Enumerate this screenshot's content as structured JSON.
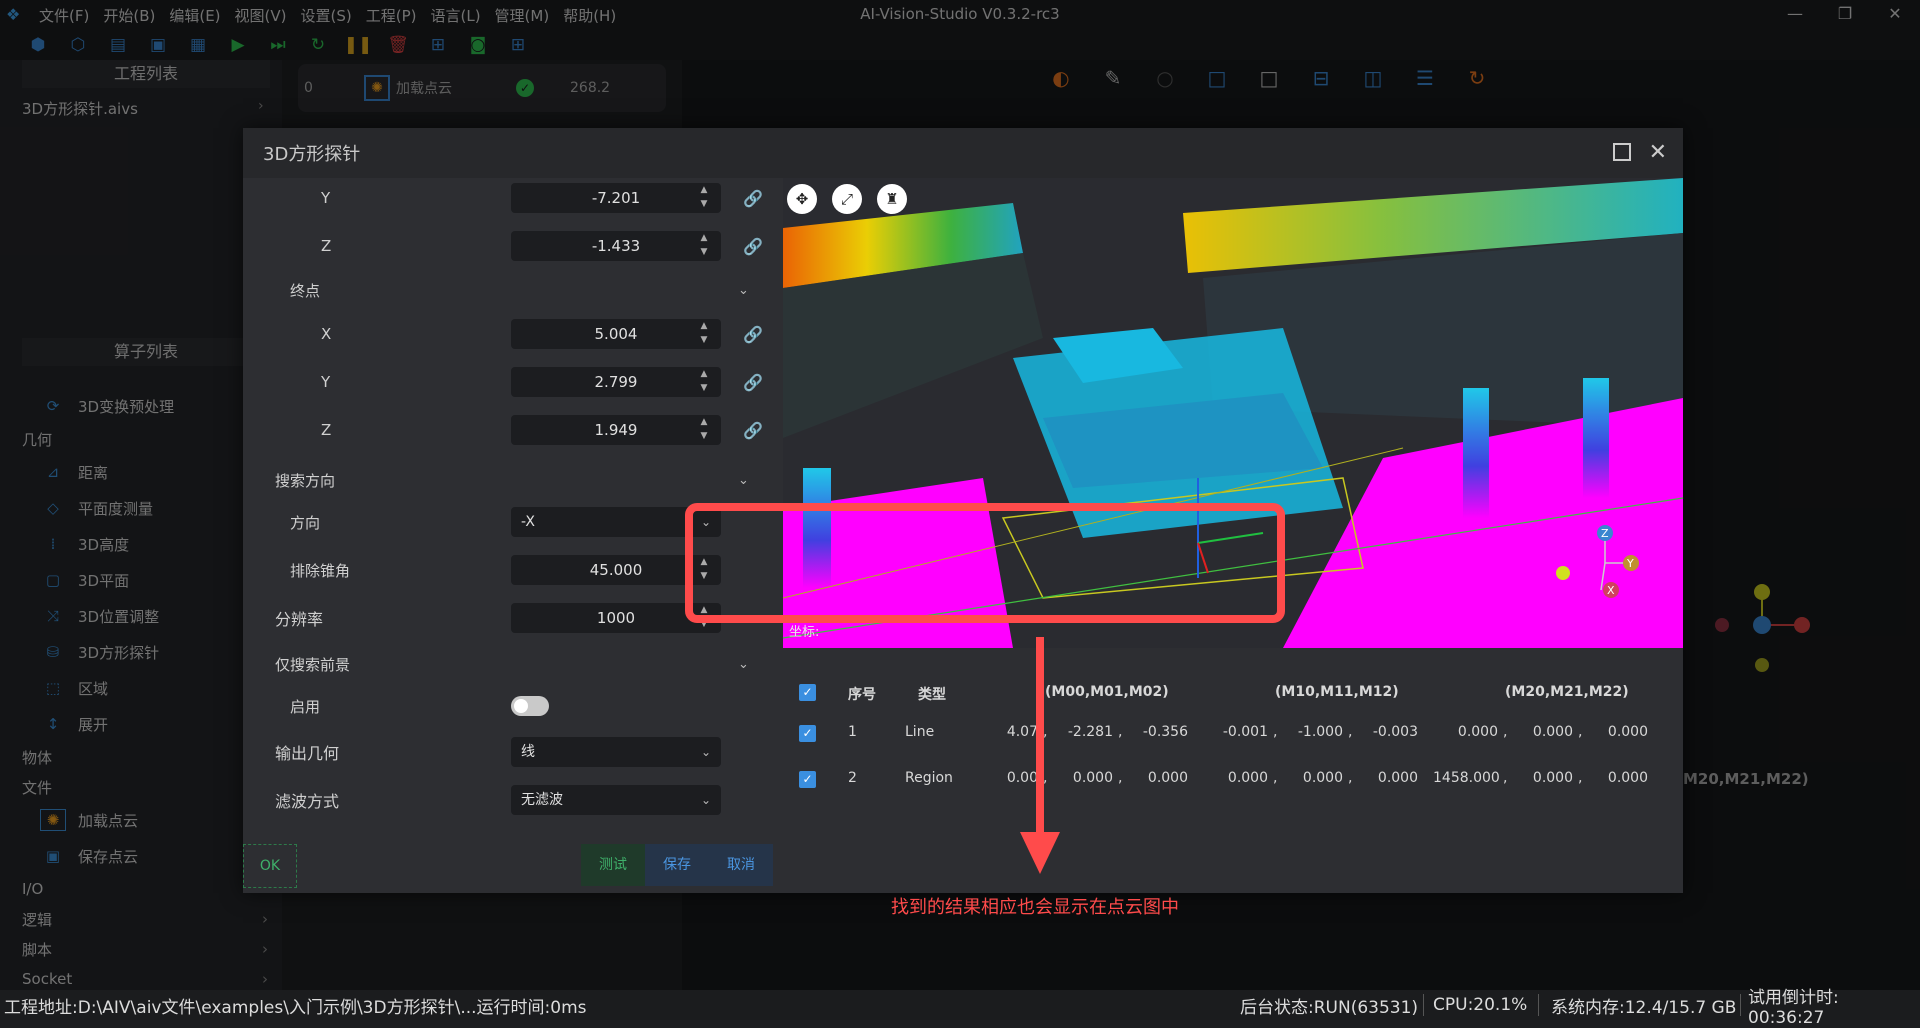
{
  "window": {
    "title": "AI-Vision-Studio V0.3.2-rc3",
    "menus": [
      "文件(F)",
      "开始(B)",
      "编辑(E)",
      "视图(V)",
      "设置(S)",
      "工程(P)",
      "语言(L)",
      "管理(M)",
      "帮助(H)"
    ]
  },
  "project_panel": {
    "title": "工程列表",
    "file": "3D方形探针.aivs"
  },
  "operator_panel": {
    "title": "算子列表",
    "items": [
      {
        "kind": "item",
        "label": "3D变换预处理",
        "icon": "transform-icon"
      },
      {
        "kind": "cat",
        "label": "几何"
      },
      {
        "kind": "item",
        "label": "距离",
        "icon": "distance-icon"
      },
      {
        "kind": "item",
        "label": "平面度测量",
        "icon": "flatness-icon"
      },
      {
        "kind": "item",
        "label": "3D高度",
        "icon": "height-icon"
      },
      {
        "kind": "item",
        "label": "3D平面",
        "icon": "plane-icon"
      },
      {
        "kind": "item",
        "label": "3D位置调整",
        "icon": "position-adjust-icon"
      },
      {
        "kind": "item",
        "label": "3D方形探针",
        "icon": "probe-icon"
      },
      {
        "kind": "item",
        "label": "区域",
        "icon": "region-icon"
      },
      {
        "kind": "item",
        "label": "展开",
        "icon": "expand-icon"
      },
      {
        "kind": "cat",
        "label": "物体"
      },
      {
        "kind": "cat",
        "label": "文件"
      },
      {
        "kind": "item",
        "label": "加载点云",
        "icon": "load-cloud-icon"
      },
      {
        "kind": "item",
        "label": "保存点云",
        "icon": "save-cloud-icon"
      },
      {
        "kind": "cat",
        "label": "I/O"
      },
      {
        "kind": "cat",
        "label": "逻辑",
        "arrow": true
      },
      {
        "kind": "cat",
        "label": "脚本",
        "arrow": true
      },
      {
        "kind": "cat",
        "label": "Socket",
        "arrow": true
      }
    ]
  },
  "process": {
    "index": "0",
    "name": "加载点云",
    "time": "268.2"
  },
  "dialog": {
    "title": "3D方形探针",
    "start_y": {
      "label": "Y",
      "value": "-7.201"
    },
    "start_z": {
      "label": "Z",
      "value": "-1.433"
    },
    "end_label": "终点",
    "end_x": {
      "label": "X",
      "value": "5.004"
    },
    "end_y": {
      "label": "Y",
      "value": "2.799"
    },
    "end_z": {
      "label": "Z",
      "value": "1.949"
    },
    "search_dir_label": "搜索方向",
    "direction": {
      "label": "方向",
      "value": "-X"
    },
    "exclude_angle": {
      "label": "排除锥角",
      "value": "45.000"
    },
    "resolution": {
      "label": "分辨率",
      "value": "1000"
    },
    "foreground_label": "仅搜索前景",
    "enable_label": "启用",
    "output_geom": {
      "label": "输出几何",
      "value": "线"
    },
    "filter": {
      "label": "滤波方式",
      "value": "无滤波"
    },
    "ok": "OK",
    "test": "测试",
    "save": "保存",
    "cancel": "取消",
    "coord_label": "坐标:"
  },
  "results": {
    "headers": [
      "序号",
      "类型",
      "(M00,M01,M02)",
      "(M10,M11,M12)",
      "(M20,M21,M22)"
    ],
    "rows": [
      {
        "idx": "1",
        "type": "Line",
        "m0": [
          "4.07",
          "-2.281",
          "-0.356"
        ],
        "m1": [
          "-0.001",
          "-1.000",
          "-0.003"
        ],
        "m2": [
          "0.000",
          "0.000",
          "0.000"
        ]
      },
      {
        "idx": "2",
        "type": "Region",
        "m0": [
          "0.00",
          "0.000",
          "0.000"
        ],
        "m1": [
          "0.000",
          "0.000",
          "0.000"
        ],
        "m2": [
          "1458.000",
          "0.000",
          "0.000"
        ]
      }
    ]
  },
  "background_header": "M20,M21,M22)",
  "annotation": "找到的结果相应也会显示在点云图中",
  "statusbar": {
    "path": "工程地址:D:\\AIV\\aiv文件\\examples\\入门示例\\3D方形探针\\...运行时间:0ms",
    "backend": "后台状态:RUN(63531)",
    "cpu": "CPU:20.1%",
    "memory": "系统内存:12.4/15.7 GB",
    "trial": "试用倒计时: 00:36:27"
  },
  "colors": {
    "accent": "#3a8fe0",
    "annotation": "#ff4b4b",
    "magenta": "#ff00ff",
    "cyan": "#1ec8e6"
  }
}
